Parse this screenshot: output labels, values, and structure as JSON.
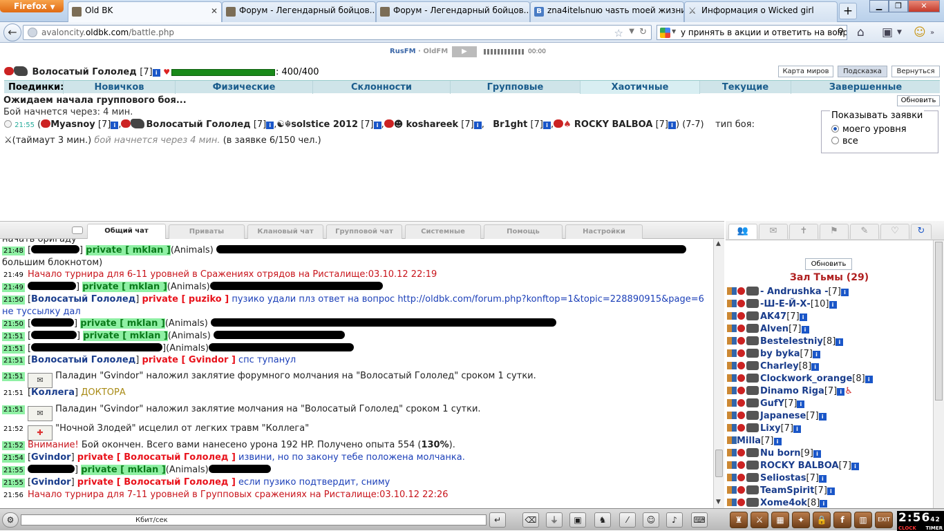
{
  "browser": {
    "menu_button": "Firefox",
    "tabs": [
      {
        "title": "Old BK"
      },
      {
        "title": "Форум - Легендарный бойцов..."
      },
      {
        "title": "Форум - Легендарный бойцов..."
      },
      {
        "title": "zna4itelьnuю чasть moeй жизни ..."
      },
      {
        "title": "Информация о Wicked girl"
      }
    ],
    "new_tab_label": "+",
    "url_prefix": "avaloncity.",
    "url_domain": "oldbk.com",
    "url_path": "/battle.php",
    "search_value": "у принять в акции и ответить на вопрос"
  },
  "radio": {
    "station1": "RusFM",
    "sep": " ∙ ",
    "station2": "OldFM",
    "time": "00:00"
  },
  "character": {
    "name": "Волосатый Гололед",
    "level": "[7]",
    "hp_text": ": 400/400"
  },
  "top_buttons": [
    {
      "label": "Карта миров"
    },
    {
      "label": "Подсказка"
    },
    {
      "label": "Вернуться"
    }
  ],
  "duels": {
    "label": "Поединки:",
    "items": [
      "Новичков",
      "Физические",
      "Склонности",
      "Групповые",
      "Хаотичные",
      "Текущие",
      "Завершенные"
    ],
    "active": "Хаотичные"
  },
  "battle": {
    "waiting": "Ожидаем начала группового боя...",
    "starts_in": "Бой начнется через: 4 мин.",
    "refresh": "Обновить",
    "request": {
      "time": "21:55",
      "participants": [
        {
          "name": "Myasnoy",
          "level": "[7]"
        },
        {
          "name": "Волосатый Гололед",
          "level": "[7]"
        },
        {
          "name": "solstice 2012",
          "level": "[7]"
        },
        {
          "name": "koshareek",
          "level": "[7]"
        },
        {
          "name": "Br1ght",
          "level": "[7]"
        },
        {
          "name": "ROCKY BALBOA",
          "level": "[7]"
        }
      ],
      "range": "(7-7)",
      "type_label": "тип боя:",
      "timeout": "(таймаут 3 мин.)",
      "starts": "бой начнется через 4 мин.",
      "count": "(в заявке 6/150 чел.)"
    }
  },
  "show_requests": {
    "legend": "Показывать заявки",
    "options": [
      "моего уровня",
      "все"
    ],
    "selected": "моего уровня"
  },
  "chat_tabs": [
    "Общий чат",
    "Приваты",
    "Клановый чат",
    "Групповой чат",
    "Системные",
    "Помощь",
    "Настройки"
  ],
  "chat_tabs_active": "Общий чат",
  "chat": {
    "line_top": "начать бригаду",
    "messages": [
      {
        "time": "21:48",
        "to": "private [ mklan ]",
        "tag": "(Animals)"
      },
      {
        "time": "",
        "cont": "большим блокнотом)"
      },
      {
        "time": "21:49",
        "system": "Начало турнира для 6-11 уровней в Сражениях отрядов на Ристалище:03.10.12 22:19"
      },
      {
        "time": "21:49",
        "to": "private [ mklan ]",
        "tag": "(Animals)"
      },
      {
        "time": "21:50",
        "from": "Волосатый Гололед",
        "to": "private [ puziko ]",
        "text": "пузико удали плз ответ на вопрос http://oldbk.com/forum.php?konftop=1&topic=228890915&page=6"
      },
      {
        "time": "",
        "cont": "не туссылку дал"
      },
      {
        "time": "21:50",
        "to": "private [ mklan ]",
        "tag": "(Animals)"
      },
      {
        "time": "21:51",
        "to": "private [ mklan ]",
        "tag": "(Animals)"
      },
      {
        "time": "21:51",
        "tag": "(Animals)"
      },
      {
        "time": "21:51",
        "from": "Волосатый Гололед",
        "to": "private [ Gvindor ]",
        "text": "спс тупанул"
      },
      {
        "time": "21:51",
        "spell": "Паладин \"Gvindor\" наложил заклятие форумного молчания на \"Волосатый Гололед\" сроком 1 сутки."
      },
      {
        "time": "21:51",
        "from": "Коллега",
        "text": "ДОКТОРА"
      },
      {
        "time": "21:51",
        "spell": "Паладин \"Gvindor\" наложил заклятие молчания на \"Волосатый Гололед\" сроком 1 сутки."
      },
      {
        "time": "21:52",
        "spell": "\"Ночной Злодей\" исцелил от легких травм \"Коллега\""
      },
      {
        "time": "21:52",
        "alert_label": "Внимание!",
        "alert": " Бой окончен. Всего вами нанесено урона 192 HP. Получено опыта 554 (",
        "alert_pct": "130%",
        "alert_end": ")."
      },
      {
        "time": "21:54",
        "from": "Gvindor",
        "to": "private [ Волосатый Гололед ]",
        "text": "извини, но по закону тебе положена молчанка."
      },
      {
        "time": "21:55",
        "to": "private [ mklan ]",
        "tag": "(Animals)"
      },
      {
        "time": "21:55",
        "from": "Gvindor",
        "to": "private [ Волосатый Гололед ]",
        "text": "если пузико подтвердит, сниму"
      },
      {
        "time": "21:56",
        "system": "Начало турнира для 7-11 уровней в Групповых сражениях на Ристалище:03.10.12 22:26"
      }
    ]
  },
  "room": {
    "refresh": "Обновить",
    "title": "Зал Тьмы (29)",
    "users": [
      {
        "name": "- Andrushka -",
        "level": "[7]"
      },
      {
        "name": "-Ш-Е-Й-Х-",
        "level": "[10]"
      },
      {
        "name": "AK47",
        "level": "[7]"
      },
      {
        "name": "Alven",
        "level": "[7]"
      },
      {
        "name": "Bestelestniy",
        "level": "[8]"
      },
      {
        "name": "by byka",
        "level": "[7]"
      },
      {
        "name": "Charley",
        "level": "[8]"
      },
      {
        "name": "Clockwork_orange",
        "level": "[8]"
      },
      {
        "name": "Dinamo Riga",
        "level": "[7]"
      },
      {
        "name": "GufY",
        "level": "[7]"
      },
      {
        "name": "Japanese",
        "level": "[7]"
      },
      {
        "name": "Lixy",
        "level": "[7]"
      },
      {
        "name": "Milla",
        "level": "[7]"
      },
      {
        "name": "Nu born",
        "level": "[9]"
      },
      {
        "name": "ROCKY BALBOA",
        "level": "[7]"
      },
      {
        "name": "Seliostas",
        "level": "[7]"
      },
      {
        "name": "TeamSpirit",
        "level": "[7]"
      },
      {
        "name": "Xome4ok",
        "level": "[8]"
      }
    ]
  },
  "bottom": {
    "kbit": "Кбит/сек",
    "clock": "2:56",
    "clock_sec": "42",
    "clock_label": "CLOCK",
    "timer_label": "TIMER"
  }
}
